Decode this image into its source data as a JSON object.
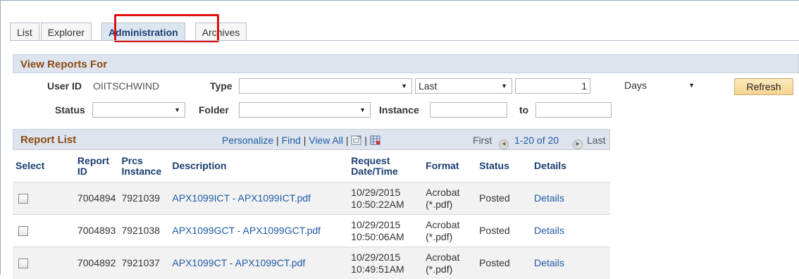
{
  "tabs": [
    {
      "label": "List"
    },
    {
      "label": "Explorer"
    },
    {
      "label": "Administration"
    },
    {
      "label": "Archives"
    }
  ],
  "view_reports": {
    "title": "View Reports For",
    "user_id_label": "User ID",
    "user_id_value": "OIITSCHWIND",
    "type_label": "Type",
    "type_value": "",
    "period_value": "Last",
    "count_value": "1",
    "unit_value": "Days",
    "refresh_label": "Refresh",
    "status_label": "Status",
    "status_value": "",
    "folder_label": "Folder",
    "folder_value": "",
    "instance_label": "Instance",
    "instance_from": "",
    "to_label": "to",
    "instance_to": ""
  },
  "report_list": {
    "title": "Report List",
    "personalize": "Personalize",
    "find": "Find",
    "view_all": "View All",
    "first": "First",
    "range": "1-20 of 20",
    "last": "Last",
    "columns": {
      "select": "Select",
      "report_id": "Report ID",
      "prcs_instance": "Prcs Instance",
      "description": "Description",
      "request_datetime": "Request Date/Time",
      "format": "Format",
      "status": "Status",
      "details": "Details"
    },
    "rows": [
      {
        "report_id": "7004894",
        "prcs_instance": "7921039",
        "description": "APX1099ICT - APX1099ICT.pdf",
        "date": "10/29/2015",
        "time": "10:50:22AM",
        "format": "Acrobat",
        "format_ext": "(*.pdf)",
        "status": "Posted",
        "details": "Details"
      },
      {
        "report_id": "7004893",
        "prcs_instance": "7921038",
        "description": "APX1099GCT - APX1099GCT.pdf",
        "date": "10/29/2015",
        "time": "10:50:06AM",
        "format": "Acrobat",
        "format_ext": "(*.pdf)",
        "status": "Posted",
        "details": "Details"
      },
      {
        "report_id": "7004892",
        "prcs_instance": "7921037",
        "description": "APX1099CT - APX1099CT.pdf",
        "date": "10/29/2015",
        "time": "10:49:51AM",
        "format": "Acrobat",
        "format_ext": "(*.pdf)",
        "status": "Posted",
        "details": "Details"
      }
    ]
  },
  "colors": {
    "accent": "#1f5aa6",
    "section_title": "#8b4a10",
    "highlight": "#e01010"
  }
}
